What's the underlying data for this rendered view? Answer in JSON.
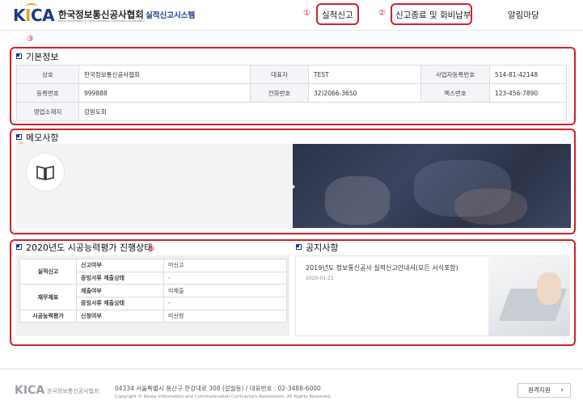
{
  "header": {
    "logo_text": "KICA",
    "org_name": "한국정보통신공사협회",
    "org_name_en": "Korea Information & Communication Contractors Association",
    "system_name": "실적신고시스템",
    "nav": [
      {
        "label": "실적신고",
        "marker": "①"
      },
      {
        "label": "신고종료 및 회비납부",
        "marker": "②"
      },
      {
        "label": "알림마당",
        "marker": ""
      }
    ]
  },
  "markers": {
    "basic": "③",
    "memo": "④",
    "status": "⑤"
  },
  "basic_info": {
    "title": "기본정보",
    "rows": [
      [
        {
          "label": "상호",
          "value": "한국정보통신공사협회"
        },
        {
          "label": "대표자",
          "value": "TEST"
        },
        {
          "label": "사업자등록번호",
          "value": "514-81-42148"
        }
      ],
      [
        {
          "label": "등록번호",
          "value": "999888"
        },
        {
          "label": "전화번호",
          "value": "32)2066-3650"
        },
        {
          "label": "팩스번호",
          "value": "123-456-7890"
        }
      ],
      [
        {
          "label": "영업소재지",
          "value": "강원도회"
        }
      ]
    ]
  },
  "memo": {
    "title": "메모사항"
  },
  "status": {
    "title": "2020년도 시공능력평가 진행상태",
    "groups": [
      {
        "category": "실적신고",
        "items": [
          {
            "item": "신고여부",
            "value": "미신고"
          },
          {
            "item": "증빙서류 제출상태",
            "value": "-"
          }
        ]
      },
      {
        "category": "재무제표",
        "items": [
          {
            "item": "제출여부",
            "value": "미제출"
          },
          {
            "item": "증빙서류 제출상태",
            "value": "-"
          }
        ]
      },
      {
        "category": "시공능력평가",
        "items": [
          {
            "item": "신청여부",
            "value": "미신청"
          }
        ]
      }
    ]
  },
  "notice": {
    "title": "공지사항",
    "items": [
      {
        "title": "2019년도 정보통신공사 실적신고안내서(모든 서식포함)",
        "date": "2020-01-21"
      }
    ]
  },
  "footer": {
    "logo_text": "KICA",
    "org_name": "한국정보통신공사협회",
    "address": "04334 서울특별시 용산구 한강대로 308 (갈월동) / 대표번호 : 02-3488-6000",
    "copyright": "Copyright © Korea Information and Communication Contractors Association. All Rights Reserved.",
    "remote_button": "원격지원",
    "remote_chevron": "›"
  },
  "colors": {
    "brand": "#1d3a8a",
    "accent": "#f0a020",
    "highlight": "#d4202a"
  }
}
